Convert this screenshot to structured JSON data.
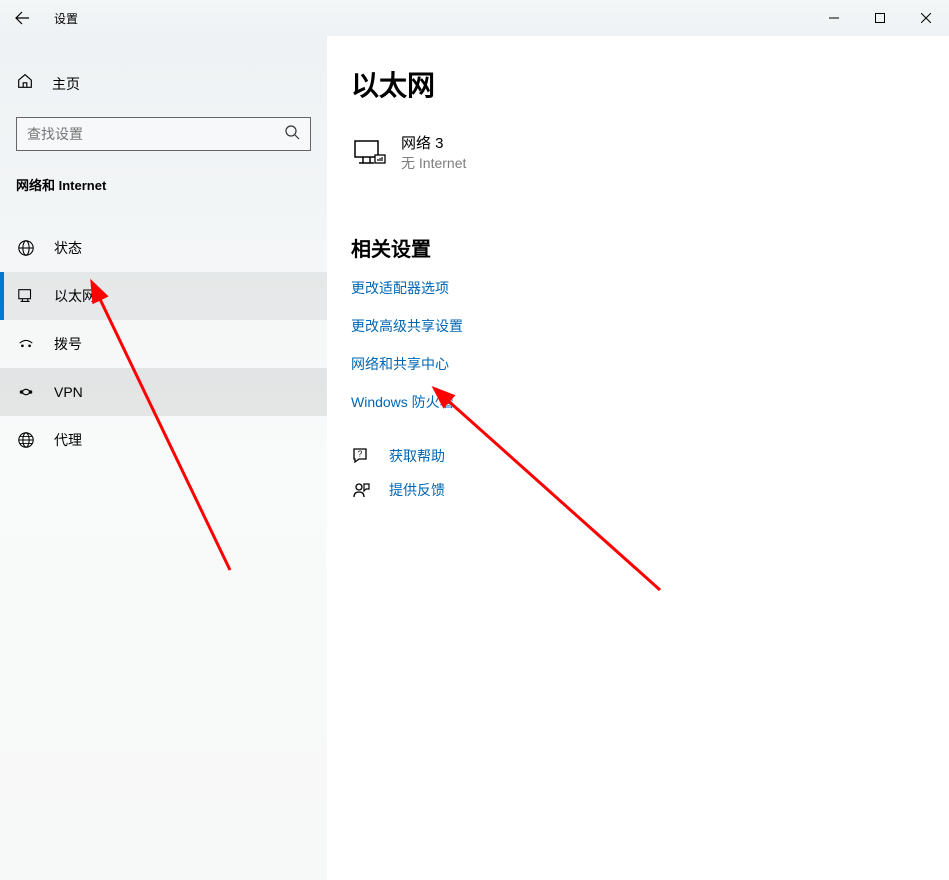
{
  "titlebar": {
    "title": "设置"
  },
  "sidebar": {
    "home_label": "主页",
    "search_placeholder": "查找设置",
    "section_label": "网络和 Internet",
    "items": [
      {
        "label": "状态"
      },
      {
        "label": "以太网"
      },
      {
        "label": "拨号"
      },
      {
        "label": "VPN"
      },
      {
        "label": "代理"
      }
    ]
  },
  "content": {
    "page_title": "以太网",
    "network": {
      "name": "网络 3",
      "status": "无 Internet"
    },
    "related": {
      "title": "相关设置",
      "links": [
        "更改适配器选项",
        "更改高级共享设置",
        "网络和共享中心",
        "Windows 防火墙"
      ]
    },
    "help": {
      "get_help": "获取帮助",
      "feedback": "提供反馈"
    }
  }
}
